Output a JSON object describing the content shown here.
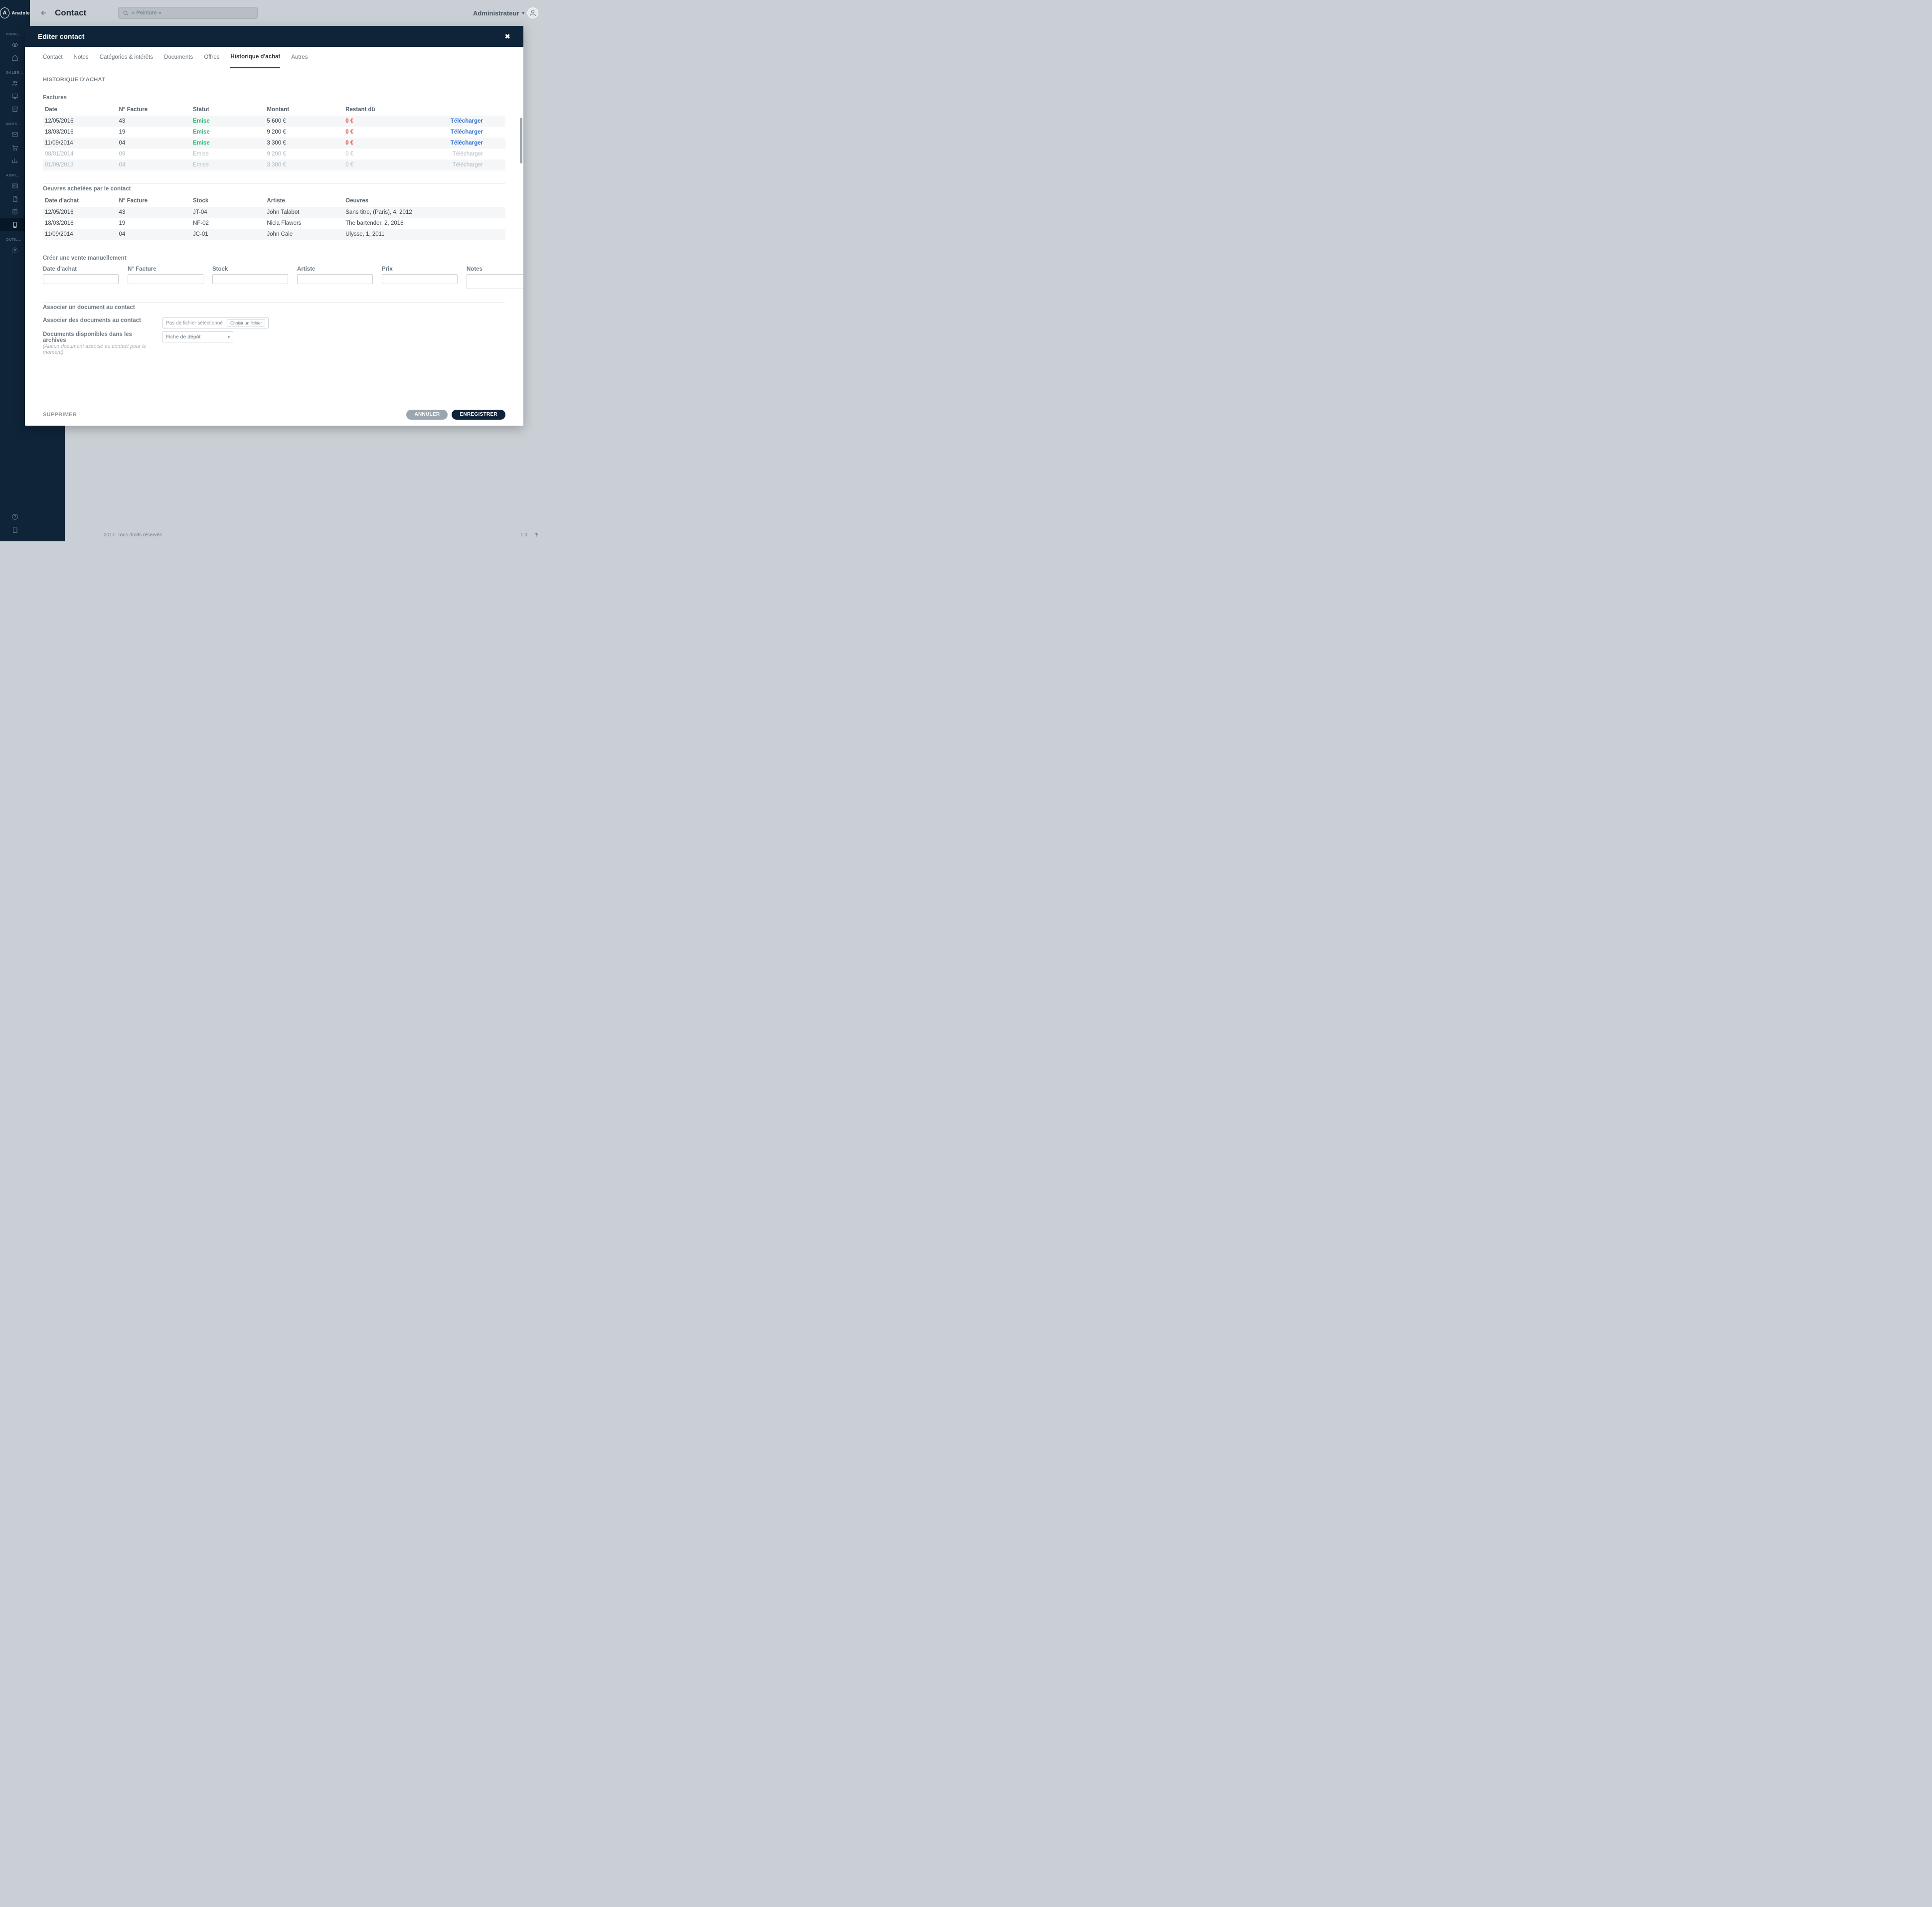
{
  "brand": {
    "initial": "A",
    "name": "Anatole"
  },
  "sidebar_groups": [
    "PRINC…",
    "GALER…",
    "MARK…",
    "ADMI…",
    "OUTIL…"
  ],
  "topbar": {
    "page_title": "Contact",
    "search_placeholder": "« Peinture »",
    "user_label": "Administrateur"
  },
  "modal": {
    "title": "Editer contact",
    "tabs": [
      "Contact",
      "Notes",
      "Catégories & intérêts",
      "Documents",
      "Offres",
      "Historique d'achat",
      "Autres"
    ],
    "active_tab": "Historique d'achat",
    "section_history_title": "HISTORIQUE D'ACHAT",
    "factures": {
      "title": "Factures",
      "headers": [
        "Date",
        "N° Facture",
        "Statut",
        "Montant",
        "Restant dû",
        ""
      ],
      "download_label": "Télécharger",
      "rows": [
        {
          "date": "12/05/2016",
          "num": "43",
          "statut": "Emise",
          "montant": "5 600 €",
          "rest": "0 €",
          "faded": false
        },
        {
          "date": "18/03/2016",
          "num": "19",
          "statut": "Emise",
          "montant": "9 200 €",
          "rest": "0 €",
          "faded": false
        },
        {
          "date": "11/09/2014",
          "num": "04",
          "statut": "Emise",
          "montant": "3 300 €",
          "rest": "0 €",
          "faded": false
        },
        {
          "date": "08/01/2014",
          "num": "09",
          "statut": "Emise",
          "montant": "9 200 €",
          "rest": "0 €",
          "faded": true
        },
        {
          "date": "01/09/2013",
          "num": "04",
          "statut": "Emise",
          "montant": "3 300 €",
          "rest": "0 €",
          "faded": true
        }
      ]
    },
    "oeuvres": {
      "title": "Oeuvres achetées par le contact",
      "headers": [
        "Date d'achat",
        "N° Facture",
        "Stock",
        "Artiste",
        "Oeuvres"
      ],
      "rows": [
        {
          "date": "12/05/2016",
          "num": "43",
          "stock": "JT-04",
          "artiste": "John Talabot",
          "oeuvre": "Sans titre, (Paris), 4, 2012"
        },
        {
          "date": "18/03/2016",
          "num": "19",
          "stock": "NF-02",
          "artiste": "Nicia Flawers",
          "oeuvre": "The bartender, 2, 2016"
        },
        {
          "date": "11/09/2014",
          "num": "04",
          "stock": "JC-01",
          "artiste": "John Cale",
          "oeuvre": "Ulysse, 1, 2011"
        }
      ]
    },
    "manual_sale": {
      "title": "Créer une vente manuellement",
      "labels": {
        "date": "Date d'achat",
        "num": "N° Facture",
        "stock": "Stock",
        "artiste": "Artiste",
        "prix": "Prix",
        "notes": "Notes"
      }
    },
    "assoc": {
      "title": "Associer un document au contact",
      "row1_label": "Associer des documents au contact",
      "file_placeholder": "Pas de fichier sélectionné",
      "file_button": "Choisir un fichier",
      "row2_label": "Documents disponibles dans les archives",
      "row2_hint": "(Aucun document associé au contact pour le moment)",
      "select_value": "Fiche de dépôt"
    },
    "footer": {
      "delete": "SUPPRIMER",
      "cancel": "ANNULER",
      "save": "ENREGISTRER"
    }
  },
  "footer": {
    "copyright": "2017. Tous droits réservés",
    "version": "1.0"
  }
}
